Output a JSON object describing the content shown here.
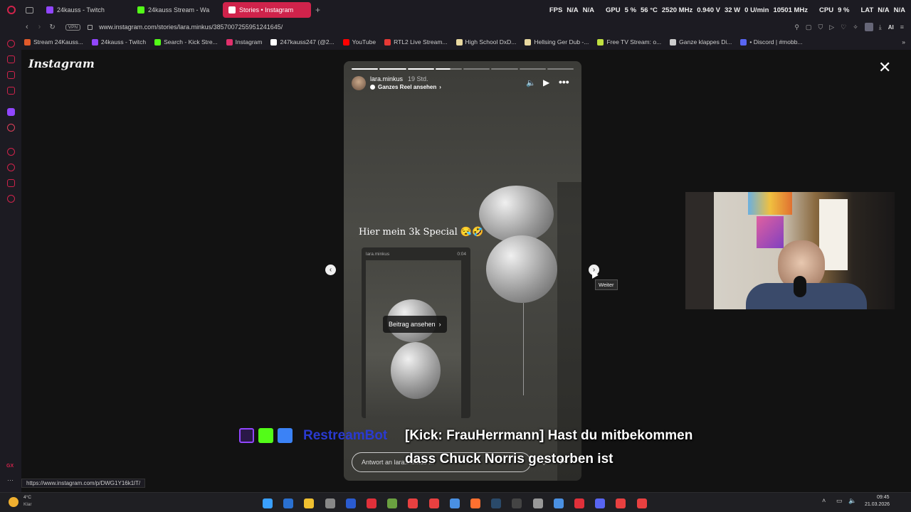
{
  "browser": {
    "tabs": [
      {
        "label": "24kauss - Twitch",
        "color": "#9146ff"
      },
      {
        "label": "24kauss Stream - Wa",
        "color": "#53fc18"
      },
      {
        "label": "Stories • Instagram",
        "color": "#e1306c"
      }
    ],
    "url": "www.instagram.com/stories/lara.minkus/3857007255951241645/",
    "vpn_label": "VPN",
    "stats": {
      "fps_label": "FPS",
      "fps_val1": "N/A",
      "fps_val2": "N/A",
      "gpu_label": "GPU",
      "gpu_load": "5 %",
      "gpu_temp": "56 °C",
      "gpu_clock": "2520 MHz",
      "gpu_volt": "0.940 V",
      "gpu_power": "32 W",
      "gpu_fan": "0 U/min",
      "gpu_mem": "10501 MHz",
      "cpu_label": "CPU",
      "cpu_load": "9 %",
      "lat_label": "LAT",
      "lat_val1": "N/A",
      "lat_val2": "N/A"
    },
    "bookmarks": [
      {
        "label": "Stream 24Kauss...",
        "color": "#e05a2a"
      },
      {
        "label": "24kauss - Twitch",
        "color": "#9146ff"
      },
      {
        "label": "Search - Kick Stre...",
        "color": "#53fc18"
      },
      {
        "label": "Instagram",
        "color": "#e1306c"
      },
      {
        "label": "247kauss247 (@2...",
        "color": "#ffffff"
      },
      {
        "label": "YouTube",
        "color": "#ff0000"
      },
      {
        "label": "RTL2 Live Stream...",
        "color": "#e53935"
      },
      {
        "label": "High School DxD...",
        "color": "#e8d8a0"
      },
      {
        "label": "Hellsing Ger Dub -...",
        "color": "#e8d8a0"
      },
      {
        "label": "Free TV Stream: o...",
        "color": "#c0e040"
      },
      {
        "label": "Ganze klappes Di...",
        "color": "#cccccc"
      },
      {
        "label": "• Discord | #mobb...",
        "color": "#5865f2"
      }
    ],
    "status_url": "https://www.instagram.com/p/DWG1Y16k1lT/"
  },
  "instagram": {
    "logo": "Instagram",
    "story": {
      "username": "lara.minkus",
      "time_ago": "19 Std.",
      "reel_link": "Ganzes Reel ansehen",
      "progress_segments": 8,
      "active_segment": 3,
      "caption": "Hier mein 3k Special 😪🤣",
      "post_card": {
        "username": "lara.minkus",
        "duration": "0:04",
        "button": "Beitrag ansehen"
      },
      "reply_placeholder": "Antwort an lara.minkus ..."
    },
    "next_tooltip": "Weiter"
  },
  "overlay": {
    "bot_name": "RestreamBot",
    "message_line1": "[Kick: FrauHerrmann] Hast du mitbekommen",
    "message_line2": "dass Chuck Norris gestorben ist"
  },
  "taskbar": {
    "weather_temp": "4°C",
    "weather_desc": "Klar",
    "time": "09:45",
    "date": "21.03.2026"
  }
}
